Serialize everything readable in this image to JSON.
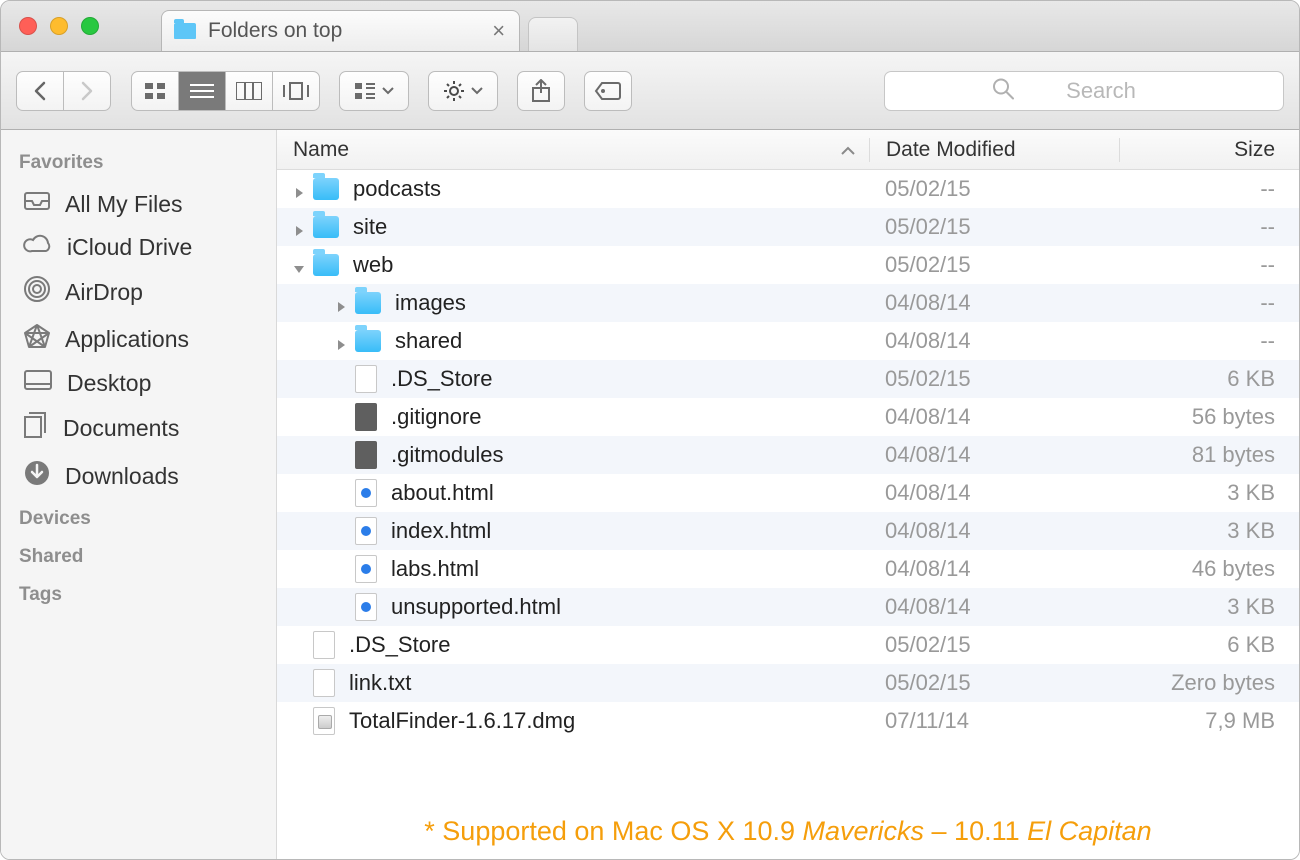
{
  "tab": {
    "title": "Folders on top"
  },
  "search": {
    "placeholder": "Search"
  },
  "sidebar": {
    "sections": [
      {
        "header": "Favorites",
        "items": [
          {
            "icon": "tray",
            "label": "All My Files"
          },
          {
            "icon": "cloud",
            "label": "iCloud Drive"
          },
          {
            "icon": "airdrop",
            "label": "AirDrop"
          },
          {
            "icon": "apps",
            "label": "Applications"
          },
          {
            "icon": "desktop",
            "label": "Desktop"
          },
          {
            "icon": "docs",
            "label": "Documents"
          },
          {
            "icon": "download",
            "label": "Downloads"
          }
        ]
      },
      {
        "header": "Devices",
        "items": []
      },
      {
        "header": "Shared",
        "items": []
      },
      {
        "header": "Tags",
        "items": []
      }
    ]
  },
  "columns": {
    "name": "Name",
    "date": "Date Modified",
    "size": "Size"
  },
  "rows": [
    {
      "indent": 0,
      "disclosure": "closed",
      "kind": "folder",
      "name": "podcasts",
      "date": "05/02/15",
      "size": "--"
    },
    {
      "indent": 0,
      "disclosure": "closed",
      "kind": "folder",
      "name": "site",
      "date": "05/02/15",
      "size": "--"
    },
    {
      "indent": 0,
      "disclosure": "open",
      "kind": "folder",
      "name": "web",
      "date": "05/02/15",
      "size": "--"
    },
    {
      "indent": 1,
      "disclosure": "closed",
      "kind": "folder",
      "name": "images",
      "date": "04/08/14",
      "size": "--"
    },
    {
      "indent": 1,
      "disclosure": "closed",
      "kind": "folder",
      "name": "shared",
      "date": "04/08/14",
      "size": "--"
    },
    {
      "indent": 1,
      "disclosure": "none",
      "kind": "file",
      "name": ".DS_Store",
      "date": "05/02/15",
      "size": "6 KB"
    },
    {
      "indent": 1,
      "disclosure": "none",
      "kind": "config",
      "name": ".gitignore",
      "date": "04/08/14",
      "size": "56 bytes"
    },
    {
      "indent": 1,
      "disclosure": "none",
      "kind": "config",
      "name": ".gitmodules",
      "date": "04/08/14",
      "size": "81 bytes"
    },
    {
      "indent": 1,
      "disclosure": "none",
      "kind": "html",
      "name": "about.html",
      "date": "04/08/14",
      "size": "3 KB"
    },
    {
      "indent": 1,
      "disclosure": "none",
      "kind": "html",
      "name": "index.html",
      "date": "04/08/14",
      "size": "3 KB"
    },
    {
      "indent": 1,
      "disclosure": "none",
      "kind": "html",
      "name": "labs.html",
      "date": "04/08/14",
      "size": "46 bytes"
    },
    {
      "indent": 1,
      "disclosure": "none",
      "kind": "html",
      "name": "unsupported.html",
      "date": "04/08/14",
      "size": "3 KB"
    },
    {
      "indent": 0,
      "disclosure": "none",
      "kind": "file",
      "name": ".DS_Store",
      "date": "05/02/15",
      "size": "6 KB"
    },
    {
      "indent": 0,
      "disclosure": "none",
      "kind": "file",
      "name": "link.txt",
      "date": "05/02/15",
      "size": "Zero bytes"
    },
    {
      "indent": 0,
      "disclosure": "none",
      "kind": "dmg",
      "name": "TotalFinder-1.6.17.dmg",
      "date": "07/11/14",
      "size": "7,9 MB"
    }
  ],
  "footer": {
    "prefix": "* Supported on Mac OS X 10.9 ",
    "em1": "Mavericks",
    "mid": " – 10.11 ",
    "em2": "El Capitan"
  }
}
